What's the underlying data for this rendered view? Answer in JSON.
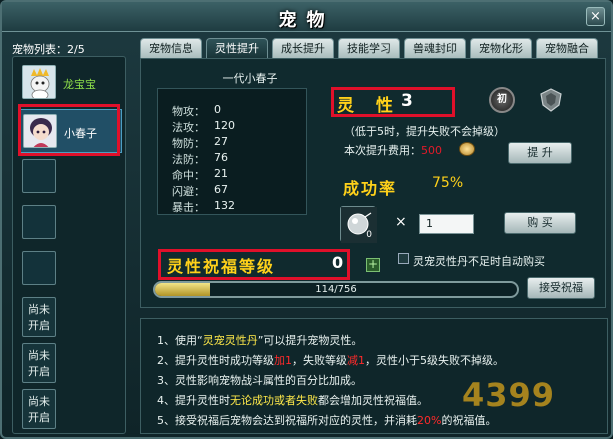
{
  "window": {
    "title": "宠物",
    "close": "×"
  },
  "pet_list": {
    "title": "宠物列表：2/5",
    "pets": [
      {
        "name": "龙宝宝",
        "color": "#8fe04a"
      },
      {
        "name": "小春子",
        "color": "#ffffff"
      }
    ],
    "locked_label": "尚未开启",
    "locked_lines": [
      "尚未",
      "开启"
    ]
  },
  "tabs": [
    "宠物信息",
    "灵性提升",
    "成长提升",
    "技能学习",
    "兽魂封印",
    "宠物化形",
    "宠物融合"
  ],
  "active_tab": 1,
  "pet_header": "一代小春子",
  "stats": [
    {
      "label": "物攻：",
      "value": "0"
    },
    {
      "label": "法攻：",
      "value": "120"
    },
    {
      "label": "物防：",
      "value": "27"
    },
    {
      "label": "法防：",
      "value": "76"
    },
    {
      "label": "命中：",
      "value": "21"
    },
    {
      "label": "闪避：",
      "value": "67"
    },
    {
      "label": "暴击：",
      "value": "132"
    }
  ],
  "spirit": {
    "label": "灵 性",
    "value": "3",
    "badge_text": "初",
    "hint": "（低于5时，提升失败不会掉级）",
    "cost_label": "本次提升费用：",
    "cost_value": "500",
    "upgrade_button": "提 升"
  },
  "success": {
    "label": "成功率",
    "value": "75%"
  },
  "item": {
    "count": "0",
    "times_symbol": "×",
    "quantity": "1",
    "buy_button": "购 买"
  },
  "auto_use_label": "灵宠灵性丹不足时自动购买",
  "bless": {
    "label": "灵性祝福等级",
    "value": "0",
    "plus_symbol": "+",
    "progress_text": "114/756",
    "progress_fraction": 0.151,
    "accept_button": "接受祝福"
  },
  "notes": [
    {
      "parts": [
        [
          "1、使用“",
          ""
        ],
        [
          "灵宠灵性丹",
          "y"
        ],
        [
          "”可以提升宠物灵性。",
          ""
        ]
      ]
    },
    {
      "parts": [
        [
          "2、提升灵性时成功等级",
          ""
        ],
        [
          "加1",
          "r"
        ],
        [
          "，失败等级",
          ""
        ],
        [
          "减1",
          "r"
        ],
        [
          "，灵性小于5级失败不掉级。",
          ""
        ]
      ]
    },
    {
      "parts": [
        [
          "3、灵性影响宠物战斗属性的百分比加成。",
          ""
        ]
      ]
    },
    {
      "parts": [
        [
          "4、提升灵性时",
          ""
        ],
        [
          "无论成功或者失败",
          "y"
        ],
        [
          "都会增加灵性祝福值。",
          ""
        ]
      ]
    },
    {
      "parts": [
        [
          "5、接受祝福后宠物会达到祝福所对应的灵性，并消耗",
          ""
        ],
        [
          "20%",
          "r"
        ],
        [
          "的祝福值。",
          ""
        ]
      ]
    }
  ],
  "watermark": "4399"
}
